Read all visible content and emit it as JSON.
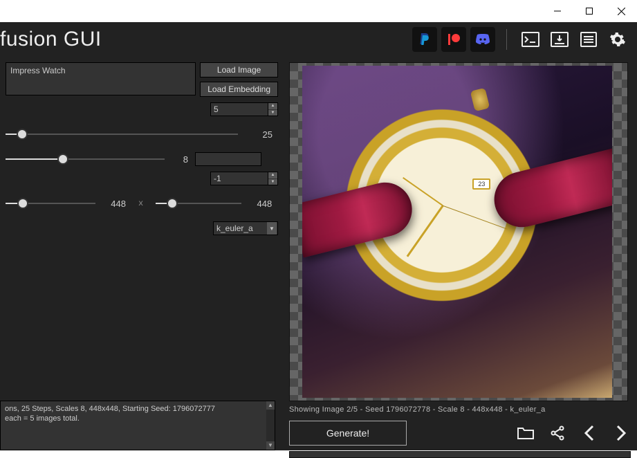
{
  "window": {
    "app_title": "fusion GUI"
  },
  "header_icons": {
    "paypal": "paypal-icon",
    "patreon": "patreon-icon",
    "discord": "discord-icon",
    "terminal": "terminal-icon",
    "download": "download-queue-icon",
    "list": "list-icon",
    "settings": "gear-icon"
  },
  "controls": {
    "prompt": "Impress Watch",
    "load_image_label": "Load Image",
    "load_embedding_label": "Load Embedding",
    "images_count": "5",
    "steps": {
      "value": 25
    },
    "scale": {
      "value": 8
    },
    "scale_text_input": "",
    "seed_input": "-1",
    "width": {
      "value": 448
    },
    "height": {
      "value": 448
    },
    "dim_separator": "x",
    "sampler": "k_euler_a"
  },
  "status": {
    "line1": "ons, 25 Steps, Scales 8, 448x448, Starting Seed: 1796072777",
    "line2": " each = 5 images total."
  },
  "preview": {
    "caption": "Showing Image 2/5 - Seed 1796072778 - Scale 8 - 448x448 - k_euler_a",
    "generate_label": "Generate!",
    "date_window": "23"
  }
}
